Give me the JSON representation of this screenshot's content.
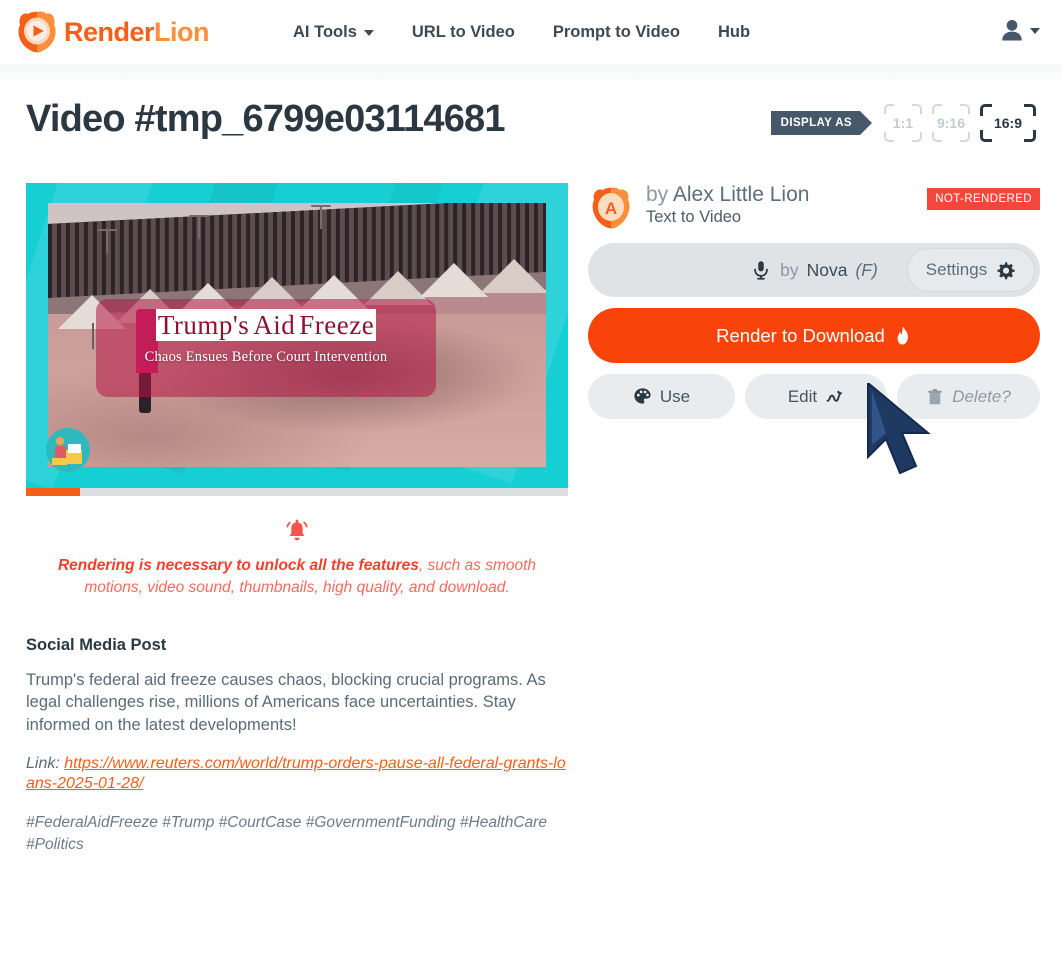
{
  "nav": {
    "brand": {
      "first": "Render",
      "second": "Lion",
      "logo_icon": "lion-play-logo"
    },
    "links": [
      {
        "label": "AI Tools",
        "has_caret": true
      },
      {
        "label": "URL to Video",
        "has_caret": false
      },
      {
        "label": "Prompt to Video",
        "has_caret": false
      },
      {
        "label": "Hub",
        "has_caret": false
      }
    ],
    "user_menu": {
      "icon": "user-avatar-icon",
      "caret": true
    }
  },
  "page": {
    "title": "Video #tmp_6799e03114681"
  },
  "display_as": {
    "tag_label": "DISPLAY AS",
    "options": [
      {
        "label": "1:1",
        "active": false
      },
      {
        "label": "9:16",
        "active": false
      },
      {
        "label": "16:9",
        "active": true
      }
    ]
  },
  "video": {
    "headline_words": [
      "Trump's",
      "Aid",
      "Freeze"
    ],
    "subtitle": "Chaos Ensues Before Court Intervention",
    "badge_icon": "person-at-desk-badge",
    "progress_percent": 10
  },
  "warning": {
    "icon": "alert-bell-icon",
    "bold": "Rendering is necessary to unlock all the features",
    "rest": ", such as smooth motions, video sound, thumbnails, high quality, and download."
  },
  "post": {
    "heading": "Social Media Post",
    "body": "Trump's federal aid freeze causes chaos, blocking crucial programs. As legal challenges rise, millions of Americans face uncertainties. Stay informed on the latest developments!",
    "link_label": "Link:",
    "link_url": "https://www.reuters.com/world/trump-orders-pause-all-federal-grants-loans-2025-01-28/",
    "hashtags": "#FederalAidFreeze #Trump #CourtCase #GovernmentFunding #HealthCare #Politics"
  },
  "owner": {
    "avatar_icon": "lion-avatar-a",
    "by_prefix": "by ",
    "name": "Alex Little Lion",
    "type": "Text to Video",
    "status_badge": "NOT-RENDERED"
  },
  "voice": {
    "mic_icon": "microphone-icon",
    "by_prefix": "by ",
    "name": "Nova",
    "gender": "(F)",
    "settings_label": "Settings",
    "settings_icon": "gear-icon"
  },
  "actions": {
    "render_label": "Render to Download",
    "render_icon": "flame-icon",
    "use_label": "Use",
    "use_icon": "palette-icon",
    "edit_label": "Edit",
    "edit_icon": "pen-squiggle-icon",
    "delete_label": "Delete?",
    "delete_icon": "trash-icon"
  },
  "pointer": {
    "icon": "mouse-arrow-cursor"
  },
  "colors": {
    "brand_orange": "#f4601a",
    "brand_orange_light": "#fd8f3c",
    "render_orange": "#f8440a",
    "status_red": "#f4473c",
    "warn_red": "#f96a5c",
    "dark_slate": "#2b3842",
    "teal": "#16cfd4"
  }
}
